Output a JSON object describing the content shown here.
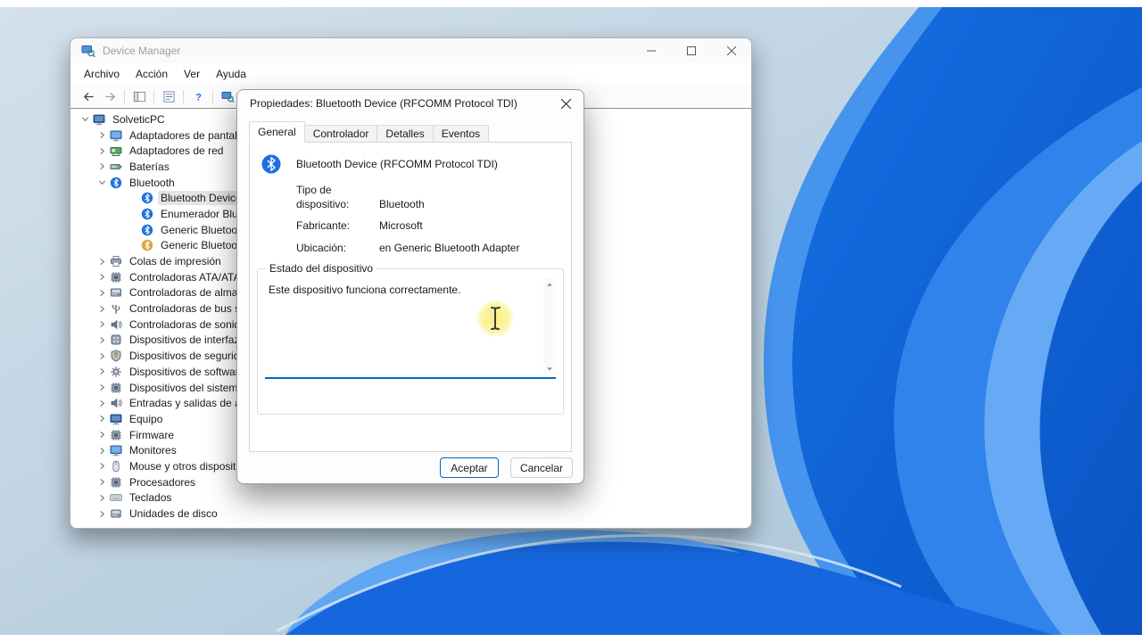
{
  "colors": {
    "accent": "#0067c0",
    "bluetooth_icon": "#1d6fe0",
    "wallpaper_blue": "#0f63d6"
  },
  "device_manager": {
    "title": "Device Manager",
    "menu_items": [
      "Archivo",
      "Acción",
      "Ver",
      "Ayuda"
    ],
    "toolbar": [
      "back",
      "forward",
      "show-console-tree",
      "properties",
      "help",
      "scan-hardware"
    ],
    "tree": [
      {
        "label": "SolveticPC",
        "icon": "computer",
        "chevron": "expanded",
        "level": 0
      },
      {
        "label": "Adaptadores de pantalla",
        "icon": "display",
        "chevron": "collapsed",
        "level": 1
      },
      {
        "label": "Adaptadores de red",
        "icon": "network",
        "chevron": "collapsed",
        "level": 1
      },
      {
        "label": "Baterías",
        "icon": "battery",
        "chevron": "collapsed",
        "level": 1
      },
      {
        "label": "Bluetooth",
        "icon": "bluetooth",
        "chevron": "expanded",
        "level": 1
      },
      {
        "label": "Bluetooth Device (RFCOMM Protocol TDI)",
        "icon": "bluetooth",
        "level": 2,
        "selected": true
      },
      {
        "label": "Enumerador Bluetooth LE de Microsoft",
        "icon": "bluetooth",
        "level": 2
      },
      {
        "label": "Generic Bluetooth Adapter",
        "icon": "bluetooth",
        "level": 2
      },
      {
        "label": "Generic Bluetooth Radio",
        "icon": "bluetooth-radio",
        "level": 2
      },
      {
        "label": "Colas de impresión",
        "icon": "printer",
        "chevron": "collapsed",
        "level": 1
      },
      {
        "label": "Controladoras ATA/ATAPI IDE",
        "icon": "chip",
        "chevron": "collapsed",
        "level": 1
      },
      {
        "label": "Controladoras de almacenamiento",
        "icon": "storage",
        "chevron": "collapsed",
        "level": 1
      },
      {
        "label": "Controladoras de bus serie universal",
        "icon": "usb",
        "chevron": "collapsed",
        "level": 1
      },
      {
        "label": "Controladoras de sonido y vídeo y dispositivos de juego",
        "icon": "sound",
        "chevron": "collapsed",
        "level": 1
      },
      {
        "label": "Dispositivos de interfaz de usuario (HID)",
        "icon": "hid",
        "chevron": "collapsed",
        "level": 1
      },
      {
        "label": "Dispositivos de seguridad",
        "icon": "security",
        "chevron": "collapsed",
        "level": 1
      },
      {
        "label": "Dispositivos de software",
        "icon": "software",
        "chevron": "collapsed",
        "level": 1
      },
      {
        "label": "Dispositivos del sistema",
        "icon": "chip",
        "chevron": "collapsed",
        "level": 1
      },
      {
        "label": "Entradas y salidas de audio",
        "icon": "sound",
        "chevron": "collapsed",
        "level": 1
      },
      {
        "label": "Equipo",
        "icon": "computer",
        "chevron": "collapsed",
        "level": 1
      },
      {
        "label": "Firmware",
        "icon": "chip",
        "chevron": "collapsed",
        "level": 1
      },
      {
        "label": "Monitores",
        "icon": "display",
        "chevron": "collapsed",
        "level": 1
      },
      {
        "label": "Mouse y otros dispositivos señaladores",
        "icon": "mouse",
        "chevron": "collapsed",
        "level": 1
      },
      {
        "label": "Procesadores",
        "icon": "chip",
        "chevron": "collapsed",
        "level": 1
      },
      {
        "label": "Teclados",
        "icon": "keyboard",
        "chevron": "collapsed",
        "level": 1
      },
      {
        "label": "Unidades de disco",
        "icon": "disk",
        "chevron": "collapsed",
        "level": 1
      }
    ]
  },
  "dialog": {
    "title": "Propiedades: Bluetooth Device (RFCOMM Protocol TDI)",
    "tabs": [
      "General",
      "Controlador",
      "Detalles",
      "Eventos"
    ],
    "active_tab": "General",
    "device_name": "Bluetooth Device (RFCOMM Protocol TDI)",
    "fields": [
      {
        "label": "Tipo de dispositivo:",
        "value": "Bluetooth"
      },
      {
        "label": "Fabricante:",
        "value": "Microsoft"
      },
      {
        "label": "Ubicación:",
        "value": "en Generic Bluetooth Adapter"
      }
    ],
    "status_group_label": "Estado del dispositivo",
    "status_text": "Este dispositivo funciona correctamente.",
    "ok_label": "Aceptar",
    "cancel_label": "Cancelar"
  }
}
